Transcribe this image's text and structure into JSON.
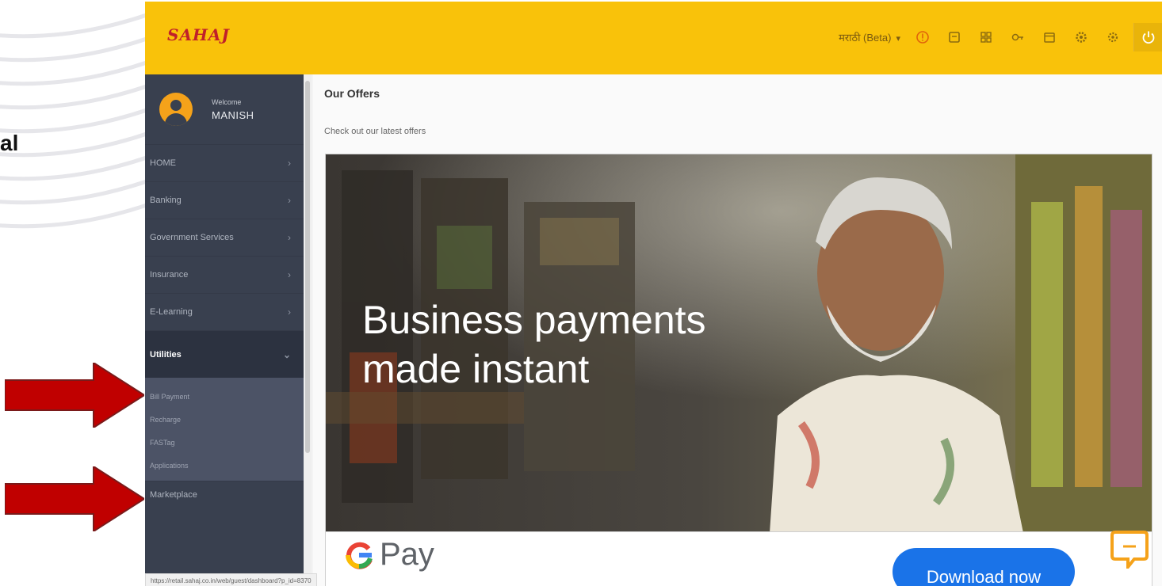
{
  "slide": {
    "side_text": "al"
  },
  "topbar": {
    "logo": "SAHAJ",
    "language_label": "मराठी (Beta)",
    "icons": [
      "info-icon",
      "document-icon",
      "grid-icon",
      "key-icon",
      "calendar-icon",
      "gear-icon",
      "settings-icon",
      "power-icon"
    ]
  },
  "sidebar": {
    "welcome_label": "Welcome",
    "user_name": "MANISH",
    "items": [
      {
        "label": "HOME",
        "chevron": "›"
      },
      {
        "label": "Banking",
        "chevron": "›"
      },
      {
        "label": "Government Services",
        "chevron": "›"
      },
      {
        "label": "Insurance",
        "chevron": "›"
      },
      {
        "label": "E-Learning",
        "chevron": "›"
      },
      {
        "label": "Utilities",
        "chevron": "⌄"
      }
    ],
    "submenu": [
      "Bill Payment",
      "Recharge",
      "FASTag",
      "Applications"
    ],
    "bottom_item": "Marketplace"
  },
  "main": {
    "title": "Our Offers",
    "subtitle": "Check out our latest offers",
    "banner": {
      "headline_line1": "Business payments",
      "headline_line2": "made instant",
      "brand": "Pay",
      "cta": "Download now"
    }
  },
  "status_url": "https://retail.sahaj.co.in/web/guest/dashboard?p_id=8370",
  "colors": {
    "topbar": "#f9c20a",
    "sidebar": "#39404f",
    "accent_arrow": "#c00000",
    "cta_blue": "#1a73e8"
  }
}
